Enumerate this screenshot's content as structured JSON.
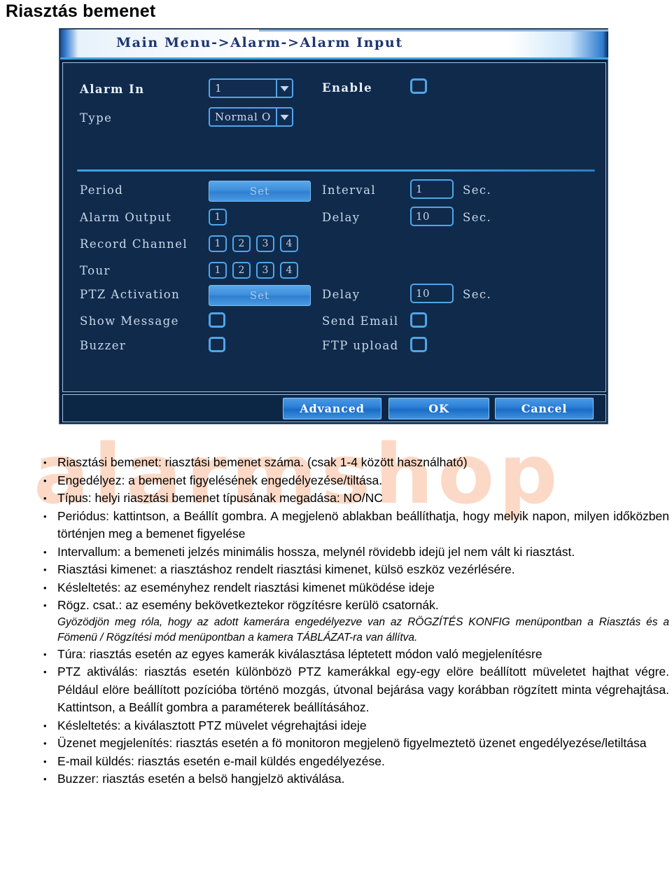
{
  "page": {
    "heading": "Riasztás bemenet",
    "watermark": "alarmshop"
  },
  "dvr": {
    "title": "Main Menu->Alarm->Alarm Input",
    "fields": {
      "alarm_in_label": "Alarm In",
      "alarm_in_value": "1",
      "enable_label": "Enable",
      "type_label": "Type",
      "type_value": "Normal O",
      "period_label": "Period",
      "period_button": "Set",
      "interval_label": "Interval",
      "interval_value": "1",
      "interval_unit": "Sec.",
      "alarm_output_label": "Alarm Output",
      "alarm_output_value": "1",
      "delay_label": "Delay",
      "delay_value": "10",
      "delay_unit": "Sec.",
      "record_channel_label": "Record Channel",
      "record_channels": [
        "1",
        "2",
        "3",
        "4"
      ],
      "tour_label": "Tour",
      "tour_channels": [
        "1",
        "2",
        "3",
        "4"
      ],
      "ptz_activation_label": "PTZ Activation",
      "ptz_button": "Set",
      "ptz_delay_label": "Delay",
      "ptz_delay_value": "10",
      "ptz_delay_unit": "Sec.",
      "show_message_label": "Show Message",
      "send_email_label": "Send Email",
      "buzzer_label": "Buzzer",
      "ftp_upload_label": "FTP upload"
    },
    "buttons": {
      "advanced": "Advanced",
      "ok": "OK",
      "cancel": "Cancel"
    },
    "colors": {
      "dialog_bg": "#102a4c",
      "accent": "#4fa6e8",
      "button_blue": "#2d7fd6",
      "title_text": "#1c3570"
    }
  },
  "notes": [
    "Riasztási bemenet: riasztási bemenet száma. (csak 1-4 között használható)",
    "Engedélyez: a bemenet figyelésének engedélyezése/tiltása.",
    "Típus: helyi riasztási bemenet típusának megadása: NO/NC",
    "Periódus: kattintson, a Beállít gombra. A megjelenö ablakban beállíthatja, hogy melyik napon, milyen időközben történjen meg a bemenet figyelése",
    "Intervallum: a bemeneti jelzés minimális hossza, melynél rövidebb idejü jel nem vált ki riasztást.",
    "Riasztási kimenet: a riasztáshoz rendelt riasztási kimenet, külsö eszköz vezérlésére.",
    "Késleltetés: az eseményhez rendelt riasztási kimenet müködése ideje",
    "Rögz. csat.: az esemény bekövetkeztekor rögzítésre kerülö csatornák.",
    "Túra: riasztás esetén az egyes kamerák kiválasztása léptetett módon való megjelenítésre",
    "PTZ aktiválás: riasztás esetén különbözö PTZ kamerákkal egy-egy elöre beállított müveletet hajthat végre. Például elöre beállított pozícióba történö mozgás, útvonal bejárása vagy korábban rögzített minta végrehajtása. Kattintson, a Beállít gombra a paraméterek beállításához.",
    "Késleltetés: a kiválasztott PTZ müvelet végrehajtási ideje",
    "Üzenet megjelenítés: riasztás esetén a fö monitoron megjelenö figyelmeztetö üzenet engedélyezése/letiltása",
    "E-mail küldés: riasztás esetén e-mail küldés engedélyezése.",
    "Buzzer: riasztás esetén a belsö hangjelzö aktiválása."
  ],
  "note_italic": "Gyözödjön meg róla, hogy az adott kamerára engedélyezve van az RÖGZÍTÉS KONFIG menüpontban a Riasztás és a Fömenü / Rögzítési mód menüpontban a kamera TÁBLÁZAT-ra van állítva."
}
